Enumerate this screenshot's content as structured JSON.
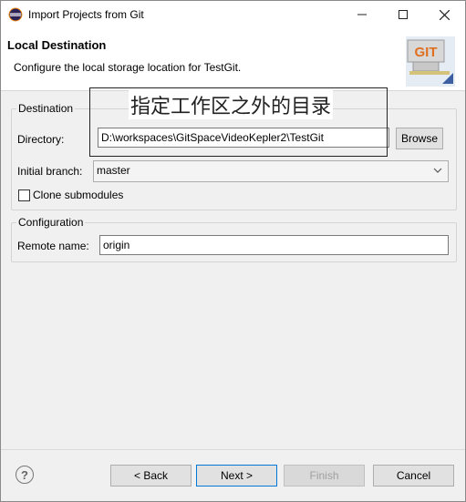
{
  "window": {
    "title": "Import Projects from Git",
    "minimize_icon": "minimize-icon",
    "maximize_icon": "maximize-icon",
    "close_icon": "close-icon"
  },
  "header": {
    "title": "Local Destination",
    "description": "Configure the local storage location for TestGit.",
    "logo_text": "GIT"
  },
  "annotation": {
    "text": "指定工作区之外的目录"
  },
  "destination": {
    "group_label": "Destination",
    "directory_label": "Directory:",
    "directory_value": "D:\\workspaces\\GitSpaceVideoKepler2\\TestGit",
    "browse_label": "Browse",
    "initial_branch_label": "Initial branch:",
    "initial_branch_value": "master",
    "clone_submodules_label": "Clone submodules",
    "clone_submodules_checked": false
  },
  "configuration": {
    "group_label": "Configuration",
    "remote_name_label": "Remote name:",
    "remote_name_value": "origin"
  },
  "footer": {
    "back_label": "< Back",
    "next_label": "Next >",
    "finish_label": "Finish",
    "cancel_label": "Cancel"
  }
}
